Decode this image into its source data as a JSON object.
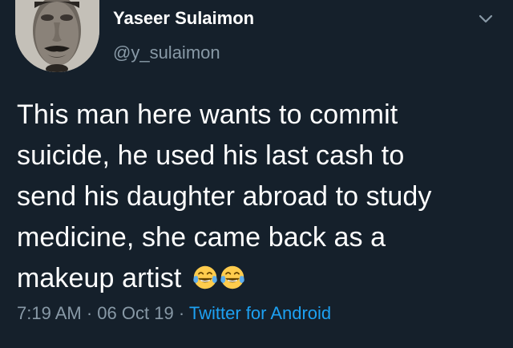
{
  "tweet": {
    "author": {
      "display_name": "Yaseer Sulaimon",
      "handle": "@y_sulaimon",
      "avatar_icon": "profile-photo"
    },
    "menu_icon": "chevron-down-icon",
    "text_lines": [
      "This man here wants to commit",
      "suicide, he used his last cash to",
      "send his daughter abroad to study",
      "medicine, she came back as a",
      "makeup artist"
    ],
    "emojis": [
      "face-with-tears-of-joy-icon",
      "face-with-tears-of-joy-icon"
    ],
    "time": "7:19 AM",
    "separator": "·",
    "date": "06 Oct 19",
    "source": "Twitter for Android"
  },
  "colors": {
    "background": "#15202b",
    "text": "#ffffff",
    "secondary_text": "#8899a6",
    "accent": "#1da1f2"
  }
}
